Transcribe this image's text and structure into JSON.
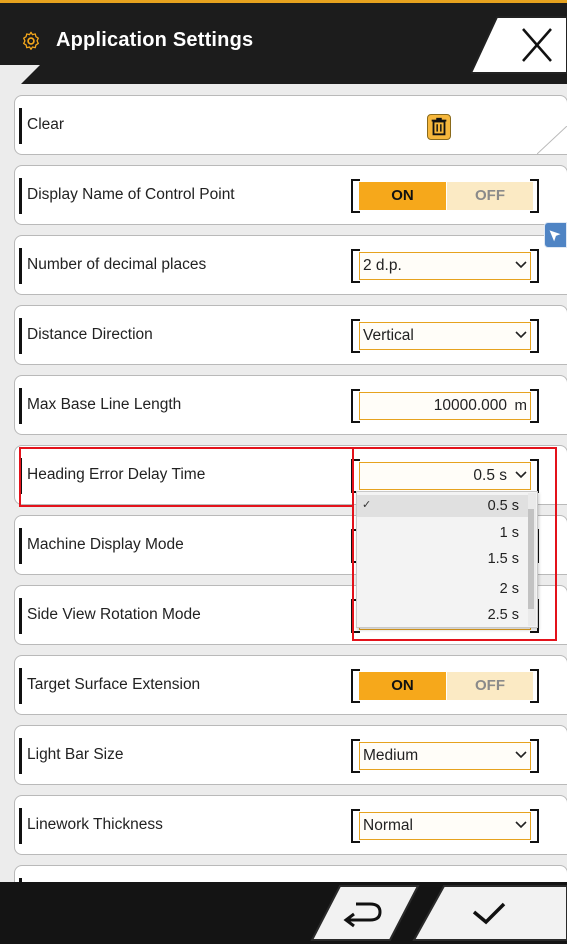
{
  "header": {
    "title": "Application Settings",
    "settings_icon": "gear-icon",
    "close_icon": "close-icon"
  },
  "rows": [
    {
      "label": "Clear",
      "control": "trash-button"
    },
    {
      "label": "Display Name of Control Point",
      "control": "toggle",
      "on": "ON",
      "off": "OFF",
      "value": "ON"
    },
    {
      "label": "Number of decimal places",
      "control": "select",
      "value": "2 d.p."
    },
    {
      "label": "Distance Direction",
      "control": "select",
      "value": "Vertical"
    },
    {
      "label": "Max Base Line Length",
      "control": "number",
      "value": "10000.000",
      "unit": "m"
    },
    {
      "label": "Heading Error Delay Time",
      "control": "select",
      "value": "0.5 s"
    },
    {
      "label": "Machine Display Mode",
      "control": "hidden"
    },
    {
      "label": "Side View Rotation Mode",
      "control": "hidden"
    },
    {
      "label": "Target Surface Extension",
      "control": "toggle",
      "on": "ON",
      "off": "OFF",
      "value": "ON"
    },
    {
      "label": "Light Bar Size",
      "control": "select",
      "value": "Medium"
    },
    {
      "label": "Linework Thickness",
      "control": "select",
      "value": "Normal"
    }
  ],
  "dropdown": {
    "options": [
      "0.5 s",
      "1 s",
      "1.5 s",
      "2 s",
      "2.5 s"
    ],
    "selected": "0.5 s",
    "check_mark": "✓"
  },
  "footer": {
    "back_icon": "return-icon",
    "confirm_icon": "checkmark-icon"
  },
  "colors": {
    "accent": "#f6a81b",
    "off_bg": "#fbeac4",
    "highlight": "#e3121b"
  }
}
